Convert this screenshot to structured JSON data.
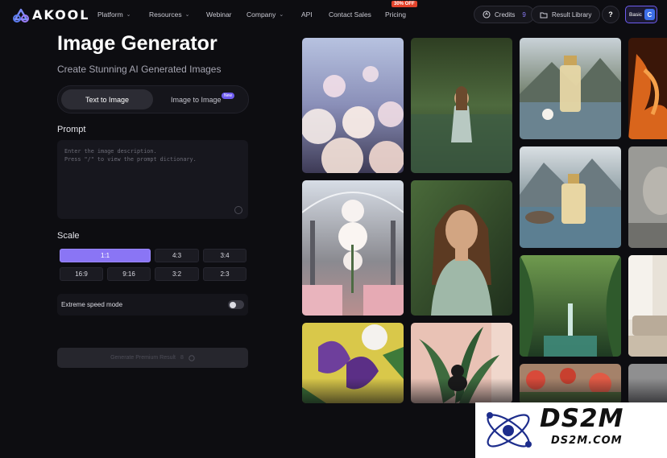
{
  "brand": {
    "name": "AKOOL"
  },
  "nav": {
    "items": [
      {
        "label": "Platform",
        "dropdown": true
      },
      {
        "label": "Resources",
        "dropdown": true
      },
      {
        "label": "Webinar",
        "dropdown": false
      },
      {
        "label": "Company",
        "dropdown": true
      },
      {
        "label": "API",
        "dropdown": false
      },
      {
        "label": "Contact Sales",
        "dropdown": false
      },
      {
        "label": "Pricing",
        "dropdown": false
      }
    ],
    "pricing_badge": "30% OFF",
    "credits_label": "Credits",
    "credits_value": "9",
    "result_library_label": "Result Library",
    "help_label": "?",
    "plan_label": "Basic",
    "avatar_initial": "C"
  },
  "page": {
    "title": "Image Generator",
    "subtitle": "Create Stunning AI Generated Images",
    "tabs": [
      {
        "label": "Text to Image",
        "active": true
      },
      {
        "label": "Image to Image",
        "active": false,
        "tag": "New"
      }
    ]
  },
  "prompt": {
    "label": "Prompt",
    "placeholder": "Enter the image description.\nPress \"/\" to view the prompt dictionary."
  },
  "scale": {
    "label": "Scale",
    "options": [
      "1:1",
      "4:3",
      "3:4",
      "16:9",
      "9:16",
      "3:2",
      "2:3"
    ],
    "selected": "1:1"
  },
  "speed_mode": {
    "label": "Extreme speed mode",
    "enabled": false
  },
  "generate": {
    "label": "Generate Premium Result",
    "cost": "8"
  },
  "gallery": {
    "images": [
      "white flowers field",
      "woman in lake",
      "perfume bottle by lake",
      "fiery abstract",
      "perfume bottle mountains",
      "grey portrait",
      "glass dome flowers",
      "woman portrait green dress",
      "jungle waterfall",
      "modern living room",
      "iris painting",
      "black cat with plants",
      "red flowers"
    ]
  },
  "watermark": {
    "title": "DS2M",
    "url": "DS2M.COM"
  },
  "colors": {
    "accent": "#8a75f5",
    "background": "#0d0d11",
    "badge": "#e2432b"
  }
}
